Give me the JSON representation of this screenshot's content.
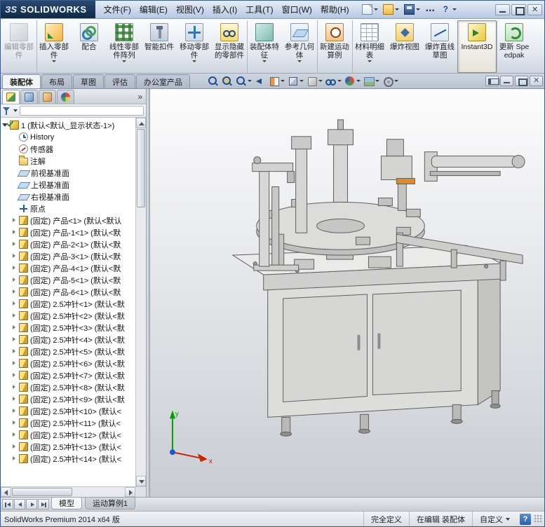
{
  "logo": {
    "mark": "ЗS",
    "name": "SOLIDWORKS"
  },
  "menu": {
    "items": [
      "文件(F)",
      "编辑(E)",
      "视图(V)",
      "插入(I)",
      "工具(T)",
      "窗口(W)",
      "帮助(H)"
    ]
  },
  "quickbar": {
    "items": [
      {
        "icon": "new",
        "caret_class": "caret"
      },
      {
        "icon": "open",
        "caret_class": "caret"
      },
      {
        "icon": "save",
        "caret_class": "caret"
      },
      {
        "icon": "more",
        "caret_class": "no-caret"
      },
      {
        "icon": "help",
        "caret_class": "caret"
      }
    ]
  },
  "commandbar": {
    "buttons": [
      {
        "label": "编辑零部件",
        "icon": "edit-component",
        "classes": "disabled",
        "caret_class": "no-caret"
      },
      {
        "label": "插入零部件",
        "icon": "insert-component",
        "classes": "sep",
        "caret_class": "caret"
      },
      {
        "label": "配合",
        "icon": "mate",
        "classes": "",
        "caret_class": "no-caret"
      },
      {
        "label": "线性零部件阵列",
        "icon": "linear-pattern",
        "classes": "",
        "caret_class": "caret"
      },
      {
        "label": "智能扣件",
        "icon": "smart-fasteners",
        "classes": "",
        "caret_class": "no-caret"
      },
      {
        "label": "移动零部件",
        "icon": "move-component",
        "classes": "",
        "caret_class": "caret"
      },
      {
        "label": "显示隐藏的零部件",
        "icon": "show-hidden-components",
        "classes": "",
        "caret_class": "no-caret"
      },
      {
        "label": "装配体特征",
        "icon": "assembly-features",
        "classes": "sep",
        "caret_class": "caret"
      },
      {
        "label": "参考几何体",
        "icon": "reference-geometry",
        "classes": "",
        "caret_class": "caret"
      },
      {
        "label": "新建运动算例",
        "icon": "new-motion-study",
        "classes": "sep",
        "caret_class": "no-caret"
      },
      {
        "label": "材料明细表",
        "icon": "bill-of-materials",
        "classes": "sep",
        "caret_class": "caret"
      },
      {
        "label": "爆炸视图",
        "icon": "exploded-view",
        "classes": "",
        "caret_class": "no-caret"
      },
      {
        "label": "爆炸直线草图",
        "icon": "explode-line-sketch",
        "classes": "",
        "caret_class": "no-caret"
      },
      {
        "label": "Instant3D",
        "icon": "instant3d",
        "classes": "pressed sep",
        "caret_class": "no-caret"
      },
      {
        "label": "更新 Speedpak",
        "icon": "update-speedpak",
        "classes": "sep",
        "caret_class": "no-caret"
      }
    ]
  },
  "ribbon_tabs": {
    "items": [
      {
        "label": "装配体",
        "state": "active"
      },
      {
        "label": "布局",
        "state": ""
      },
      {
        "label": "草图",
        "state": ""
      },
      {
        "label": "评估",
        "state": ""
      },
      {
        "label": "办公室产品",
        "state": ""
      }
    ]
  },
  "view_toolbar": {
    "items": [
      {
        "icon": "zoom-fit",
        "caret_class": "no-caret"
      },
      {
        "icon": "zoom-area",
        "caret_class": "no-caret"
      },
      {
        "icon": "zoom-selection",
        "caret_class": "caret"
      },
      {
        "icon": "previous-view",
        "caret_class": "no-caret"
      },
      {
        "icon": "section-view",
        "caret_class": "caret"
      },
      {
        "icon": "view-orientation",
        "caret_class": "caret"
      },
      {
        "icon": "display-style",
        "caret_class": "caret"
      },
      {
        "icon": "hide-show-items",
        "caret_class": "caret"
      },
      {
        "icon": "edit-appearance",
        "caret_class": "caret"
      },
      {
        "icon": "apply-scene",
        "caret_class": "caret"
      },
      {
        "icon": "view-settings",
        "caret_class": "caret"
      }
    ]
  },
  "feature_panel": {
    "chevron": "»",
    "tabs": {
      "items": [
        {
          "icon": "feature-manager",
          "state": "active"
        },
        {
          "icon": "property-manager",
          "state": ""
        },
        {
          "icon": "configuration-manager",
          "state": ""
        },
        {
          "icon": "display-manager",
          "state": ""
        }
      ]
    },
    "tree": {
      "items": [
        {
          "arrow": "expanded",
          "icon": "assembly",
          "label": "1 (默认<默认_显示状态-1>)",
          "depth": "d0"
        },
        {
          "arrow": "none",
          "icon": "history",
          "label": "History",
          "depth": "d1"
        },
        {
          "arrow": "none",
          "icon": "sensor",
          "label": "传感器",
          "depth": "d1"
        },
        {
          "arrow": "none",
          "icon": "annotations",
          "label": "注解",
          "depth": "d1"
        },
        {
          "arrow": "none",
          "icon": "plane",
          "label": "前视基准面",
          "depth": "d1"
        },
        {
          "arrow": "none",
          "icon": "plane",
          "label": "上视基准面",
          "depth": "d1"
        },
        {
          "arrow": "none",
          "icon": "plane",
          "label": "右视基准面",
          "depth": "d1"
        },
        {
          "arrow": "none",
          "icon": "origin",
          "label": "原点",
          "depth": "d1"
        },
        {
          "arrow": "collapsed",
          "icon": "part",
          "label": "(固定) 产品<1> (默认<默认",
          "depth": "d1"
        },
        {
          "arrow": "collapsed",
          "icon": "part",
          "label": "(固定) 产品-1<1> (默认<默",
          "depth": "d1"
        },
        {
          "arrow": "collapsed",
          "icon": "part",
          "label": "(固定) 产品-2<1> (默认<默",
          "depth": "d1"
        },
        {
          "arrow": "collapsed",
          "icon": "part",
          "label": "(固定) 产品-3<1> (默认<默",
          "depth": "d1"
        },
        {
          "arrow": "collapsed",
          "icon": "part",
          "label": "(固定) 产品-4<1> (默认<默",
          "depth": "d1"
        },
        {
          "arrow": "collapsed",
          "icon": "part",
          "label": "(固定) 产品-5<1> (默认<默",
          "depth": "d1"
        },
        {
          "arrow": "collapsed",
          "icon": "part",
          "label": "(固定) 产品-6<1> (默认<默",
          "depth": "d1"
        },
        {
          "arrow": "collapsed",
          "icon": "part",
          "label": "(固定) 2.5冲针<1> (默认<默",
          "depth": "d1"
        },
        {
          "arrow": "collapsed",
          "icon": "part",
          "label": "(固定) 2.5冲针<2> (默认<默",
          "depth": "d1"
        },
        {
          "arrow": "collapsed",
          "icon": "part",
          "label": "(固定) 2.5冲针<3> (默认<默",
          "depth": "d1"
        },
        {
          "arrow": "collapsed",
          "icon": "part",
          "label": "(固定) 2.5冲针<4> (默认<默",
          "depth": "d1"
        },
        {
          "arrow": "collapsed",
          "icon": "part",
          "label": "(固定) 2.5冲针<5> (默认<默",
          "depth": "d1"
        },
        {
          "arrow": "collapsed",
          "icon": "part",
          "label": "(固定) 2.5冲针<6> (默认<默",
          "depth": "d1"
        },
        {
          "arrow": "collapsed",
          "icon": "part",
          "label": "(固定) 2.5冲针<7> (默认<默",
          "depth": "d1"
        },
        {
          "arrow": "collapsed",
          "icon": "part",
          "label": "(固定) 2.5冲针<8> (默认<默",
          "depth": "d1"
        },
        {
          "arrow": "collapsed",
          "icon": "part",
          "label": "(固定) 2.5冲针<9> (默认<默",
          "depth": "d1"
        },
        {
          "arrow": "collapsed",
          "icon": "part",
          "label": "(固定) 2.5冲针<10> (默认<",
          "depth": "d1"
        },
        {
          "arrow": "collapsed",
          "icon": "part",
          "label": "(固定) 2.5冲针<11> (默认<",
          "depth": "d1"
        },
        {
          "arrow": "collapsed",
          "icon": "part",
          "label": "(固定) 2.5冲针<12> (默认<",
          "depth": "d1"
        },
        {
          "arrow": "collapsed",
          "icon": "part",
          "label": "(固定) 2.5冲针<13> (默认<",
          "depth": "d1"
        },
        {
          "arrow": "collapsed",
          "icon": "part",
          "label": "(固定) 2.5冲针<14> (默认<",
          "depth": "d1"
        }
      ]
    }
  },
  "viewport": {
    "triad": {
      "x": "x",
      "y": "y"
    }
  },
  "bottom_tabs": {
    "items": [
      {
        "label": "模型",
        "state": "active"
      },
      {
        "label": "运动算例1",
        "state": ""
      }
    ]
  },
  "statusbar": {
    "left": "SolidWorks Premium 2014 x64 版",
    "segments": [
      {
        "label": "完全定义",
        "caret_class": "no-caret"
      },
      {
        "label": "在编辑 装配体",
        "caret_class": "no-caret"
      },
      {
        "label": "自定义",
        "caret_class": "caret"
      }
    ],
    "help": "?"
  }
}
